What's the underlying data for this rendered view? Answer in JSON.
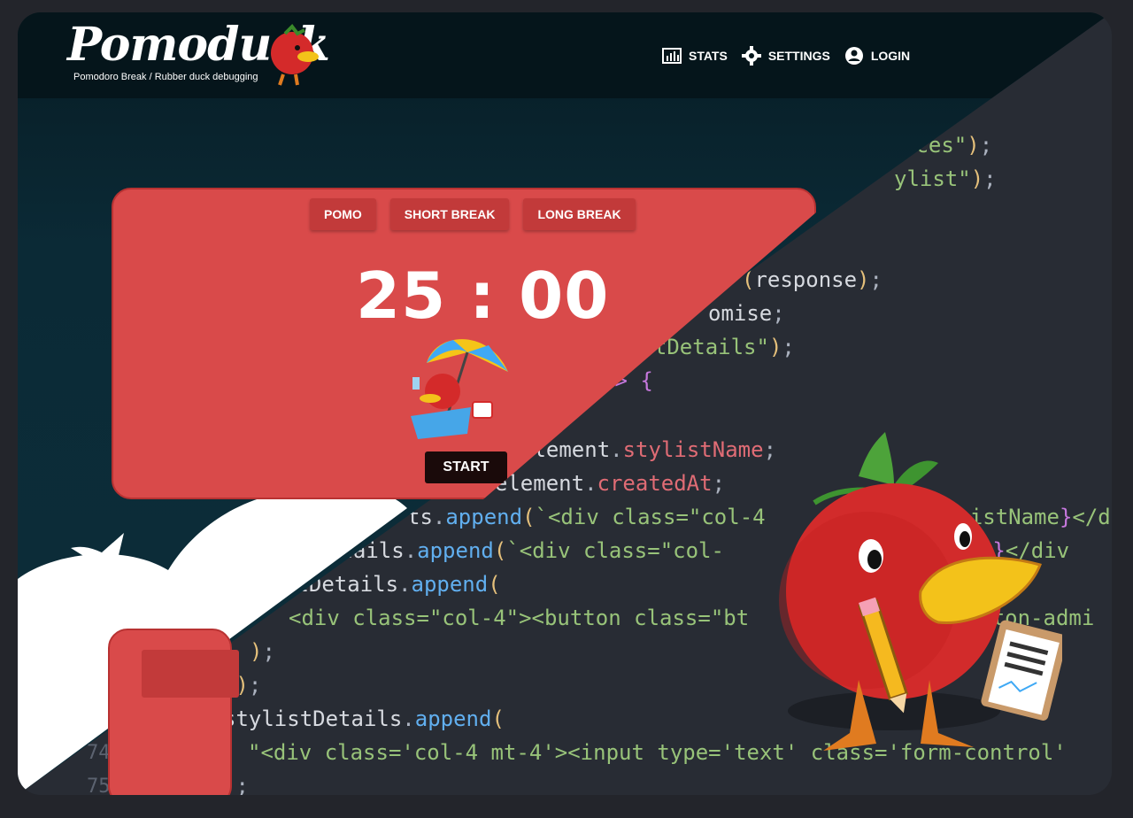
{
  "brand": {
    "name": "Pomoduck",
    "tagline": "Pomodoro Break / Rubber duck debugging"
  },
  "nav": [
    {
      "label": "STATS",
      "icon": "stats-icon"
    },
    {
      "label": "SETTINGS",
      "icon": "gear-icon"
    },
    {
      "label": "LOGIN",
      "icon": "user-icon"
    }
  ],
  "timer": {
    "tabs": [
      "POMO",
      "SHORT BREAK",
      "LONG BREAK"
    ],
    "display": "25 : 00",
    "start_label": "START"
  },
  "code": {
    "line_numbers": [
      "74",
      "75"
    ]
  },
  "colors": {
    "card": "#d94a4a",
    "header": "#05151b",
    "editor": "#282c34"
  }
}
